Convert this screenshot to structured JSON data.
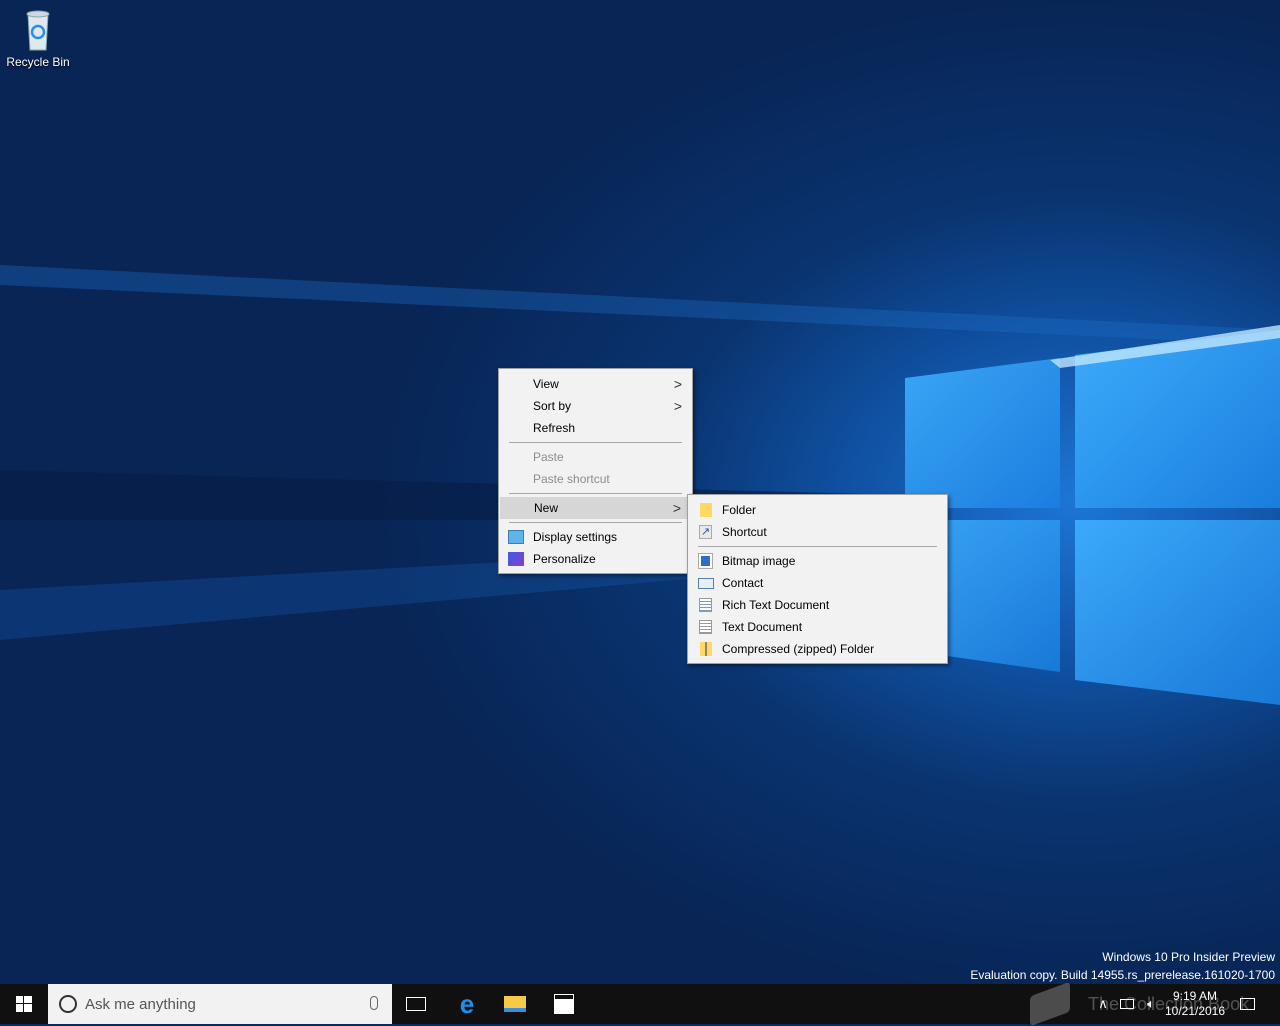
{
  "desktop": {
    "icons": [
      {
        "label": "Recycle Bin",
        "icon": "recycle-bin-icon"
      }
    ]
  },
  "context_menu": {
    "items": [
      {
        "label": "View",
        "submenu": true
      },
      {
        "label": "Sort by",
        "submenu": true
      },
      {
        "label": "Refresh"
      },
      {
        "label": "Paste",
        "disabled": true
      },
      {
        "label": "Paste shortcut",
        "disabled": true
      },
      {
        "label": "New",
        "submenu": true,
        "highlighted": true
      },
      {
        "label": "Display settings",
        "icon": "display-icon"
      },
      {
        "label": "Personalize",
        "icon": "personalize-icon"
      }
    ]
  },
  "new_submenu": {
    "items": [
      {
        "label": "Folder",
        "icon": "folder-icon"
      },
      {
        "label": "Shortcut",
        "icon": "shortcut-icon"
      },
      {
        "label": "Bitmap image",
        "icon": "bitmap-icon"
      },
      {
        "label": "Contact",
        "icon": "contact-icon"
      },
      {
        "label": "Rich Text Document",
        "icon": "rich-text-icon"
      },
      {
        "label": "Text Document",
        "icon": "text-document-icon"
      },
      {
        "label": "Compressed (zipped) Folder",
        "icon": "zip-folder-icon"
      }
    ]
  },
  "watermark": {
    "line1": "Windows 10 Pro Insider Preview",
    "line2": "Evaluation copy. Build 14955.rs_prerelease.161020-1700",
    "logo_text": "The Collection Book"
  },
  "taskbar": {
    "search_placeholder": "Ask me anything",
    "time": "9:19 AM",
    "date": "10/21/2016"
  },
  "colors": {
    "taskbar": "#101010",
    "menu": "#f2f2f2",
    "accent": "#0078d7"
  }
}
